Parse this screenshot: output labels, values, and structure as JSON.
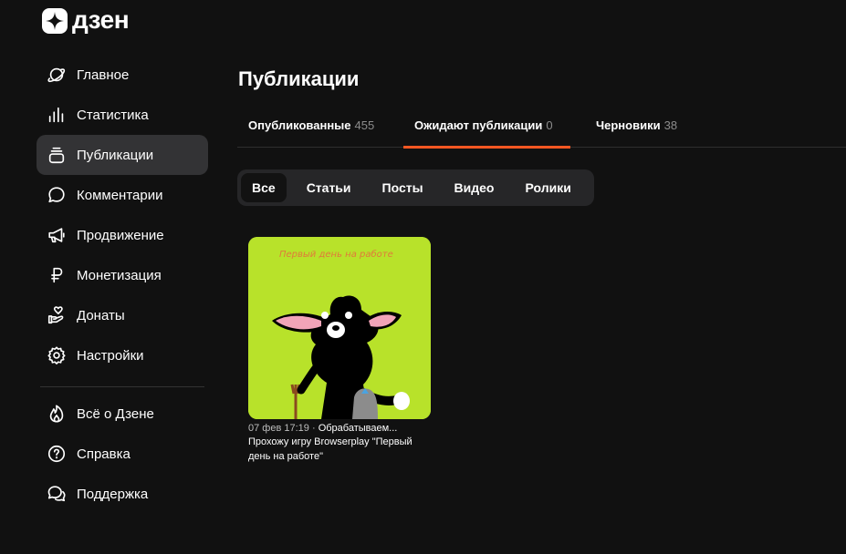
{
  "brand": {
    "name": "дзен"
  },
  "sidebar": {
    "items": [
      {
        "label": "Главное",
        "icon": "planet-icon"
      },
      {
        "label": "Статистика",
        "icon": "bar-chart-icon"
      },
      {
        "label": "Публикации",
        "icon": "stack-icon",
        "active": true
      },
      {
        "label": "Комментарии",
        "icon": "speech-bubble-icon"
      },
      {
        "label": "Продвижение",
        "icon": "megaphone-icon"
      },
      {
        "label": "Монетизация",
        "icon": "ruble-icon"
      },
      {
        "label": "Донаты",
        "icon": "heart-hand-icon"
      },
      {
        "label": "Настройки",
        "icon": "gear-icon"
      }
    ],
    "secondary": [
      {
        "label": "Всё о Дзене",
        "icon": "flame-icon"
      },
      {
        "label": "Справка",
        "icon": "question-icon"
      },
      {
        "label": "Поддержка",
        "icon": "chat-bubbles-icon"
      }
    ]
  },
  "page": {
    "title": "Публикации"
  },
  "tabs": [
    {
      "label": "Опубликованные",
      "count": "455"
    },
    {
      "label": "Ожидают публикации",
      "count": "0",
      "active": true
    },
    {
      "label": "Черновики",
      "count": "38"
    }
  ],
  "filters": [
    {
      "label": "Все",
      "active": true
    },
    {
      "label": "Статьи"
    },
    {
      "label": "Посты"
    },
    {
      "label": "Видео"
    },
    {
      "label": "Ролики"
    }
  ],
  "publication": {
    "thumbnail_caption": "Первый день на работе",
    "date": "07 фев 17:19",
    "separator": "·",
    "status": "Обрабатываем...",
    "title": "Прохожу игру Browserplay \"Первый день на работе\""
  },
  "colors": {
    "background": "#111111",
    "accent": "#ff5722",
    "active_nav": "#333335",
    "thumb_bg": "#b8e22a"
  }
}
